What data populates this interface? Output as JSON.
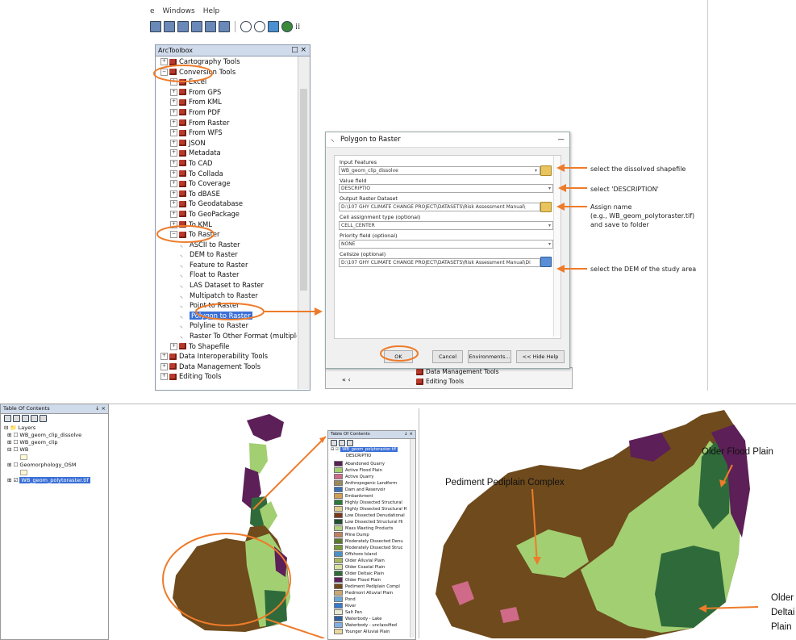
{
  "menubar": {
    "items": [
      "e",
      "Windows",
      "Help"
    ]
  },
  "arctoolbox": {
    "title": "ArcToolbox",
    "controls": "□ ×",
    "rows": [
      {
        "indent": 0,
        "type": "toolbox",
        "pm": "+",
        "label": "Cartography Tools"
      },
      {
        "indent": 0,
        "type": "toolbox",
        "pm": "−",
        "label": "Conversion Tools"
      },
      {
        "indent": 1,
        "type": "toolbox",
        "pm": "+",
        "label": "Excel"
      },
      {
        "indent": 1,
        "type": "toolbox",
        "pm": "+",
        "label": "From GPS"
      },
      {
        "indent": 1,
        "type": "toolbox",
        "pm": "+",
        "label": "From KML"
      },
      {
        "indent": 1,
        "type": "toolbox",
        "pm": "+",
        "label": "From PDF"
      },
      {
        "indent": 1,
        "type": "toolbox",
        "pm": "+",
        "label": "From Raster"
      },
      {
        "indent": 1,
        "type": "toolbox",
        "pm": "+",
        "label": "From WFS"
      },
      {
        "indent": 1,
        "type": "toolbox",
        "pm": "+",
        "label": "JSON"
      },
      {
        "indent": 1,
        "type": "toolbox",
        "pm": "+",
        "label": "Metadata"
      },
      {
        "indent": 1,
        "type": "toolbox",
        "pm": "+",
        "label": "To CAD"
      },
      {
        "indent": 1,
        "type": "toolbox",
        "pm": "+",
        "label": "To Collada"
      },
      {
        "indent": 1,
        "type": "toolbox",
        "pm": "+",
        "label": "To Coverage"
      },
      {
        "indent": 1,
        "type": "toolbox",
        "pm": "+",
        "label": "To dBASE"
      },
      {
        "indent": 1,
        "type": "toolbox",
        "pm": "+",
        "label": "To Geodatabase"
      },
      {
        "indent": 1,
        "type": "toolbox",
        "pm": "+",
        "label": "To GeoPackage"
      },
      {
        "indent": 1,
        "type": "toolbox",
        "pm": "+",
        "label": "To KML"
      },
      {
        "indent": 1,
        "type": "toolbox",
        "pm": "−",
        "label": "To Raster"
      },
      {
        "indent": 2,
        "type": "tool",
        "label": "ASCII to Raster"
      },
      {
        "indent": 2,
        "type": "tool",
        "label": "DEM to Raster"
      },
      {
        "indent": 2,
        "type": "tool",
        "label": "Feature to Raster"
      },
      {
        "indent": 2,
        "type": "tool",
        "label": "Float to Raster"
      },
      {
        "indent": 2,
        "type": "tool",
        "label": "LAS Dataset to Raster"
      },
      {
        "indent": 2,
        "type": "tool",
        "label": "Multipatch to Raster"
      },
      {
        "indent": 2,
        "type": "tool",
        "label": "Point to Raster"
      },
      {
        "indent": 2,
        "type": "tool",
        "label": "Polygon to Raster",
        "selected": true
      },
      {
        "indent": 2,
        "type": "tool",
        "label": "Polyline to Raster"
      },
      {
        "indent": 2,
        "type": "tool",
        "label": "Raster To Other Format (multiple)"
      },
      {
        "indent": 1,
        "type": "toolbox",
        "pm": "+",
        "label": "To Shapefile"
      },
      {
        "indent": 0,
        "type": "toolbox",
        "pm": "+",
        "label": "Data Interoperability Tools"
      },
      {
        "indent": 0,
        "type": "toolbox",
        "pm": "+",
        "label": "Data Management Tools"
      },
      {
        "indent": 0,
        "type": "toolbox",
        "pm": "+",
        "label": "Editing Tools"
      }
    ]
  },
  "dialog": {
    "title": "Polygon to Raster",
    "close": "—",
    "input_features_label": "Input Features",
    "input_features_value": "WB_geom_clip_dissolve",
    "value_field_label": "Value field",
    "value_field_value": "DESCRIPTIO",
    "output_label": "Output Raster Dataset",
    "output_value": "D:\\107 GHY CLIMATE CHANGE PROJECT\\DATASETS\\Risk Assessment Manual\\",
    "cell_assign_label": "Cell assignment type (optional)",
    "cell_assign_value": "CELL_CENTER",
    "priority_label": "Priority field (optional)",
    "priority_value": "NONE",
    "cellsize_label": "Cellsize (optional)",
    "cellsize_value": "D:\\107 GHY CLIMATE CHANGE PROJECT\\DATASETS\\Risk Assessment Manual\\Di",
    "ok": "OK",
    "cancel": "Cancel",
    "environments": "Environments...",
    "hide_help": "<< Hide Help"
  },
  "behind_dialog": {
    "row1": "Data Management Tools",
    "row2": "Editing Tools"
  },
  "annotations": {
    "a1": "select the dissolved shapefile",
    "a2": "select 'DESCRIPTION'",
    "a3_line1": "Assign name",
    "a3_line2": "(e.g., WB_geom_polytoraster.tif)",
    "a3_line3": "and save to folder",
    "a4": "select the DEM of the study area"
  },
  "toc": {
    "title": "Table Of Contents",
    "close": "↓ ×",
    "layers": [
      "Layers",
      "WB_geom_clip_dissolve",
      "WB_geom_clip",
      "WB",
      "Geomorphology_OSM",
      "WB_geom_polytoraster.tif"
    ]
  },
  "legend": {
    "title": "Table Of Contents",
    "header": "WB_geom_polytoraster.tif",
    "sub": "DESCRIPTIO",
    "items": [
      {
        "label": "Abandoned Quarry",
        "color": "#5a1f55"
      },
      {
        "label": "Active Flood Plain",
        "color": "#a2cf72"
      },
      {
        "label": "Active Quarry",
        "color": "#cf6a88"
      },
      {
        "label": "Anthropogenic Landform",
        "color": "#9a8a56"
      },
      {
        "label": "Dam and Reservoir",
        "color": "#3b6fb3"
      },
      {
        "label": "Embankment",
        "color": "#d0a050"
      },
      {
        "label": "Highly Dissected Structural",
        "color": "#2c7a3a"
      },
      {
        "label": "Highly Dissected Structural H",
        "color": "#e0cc8a"
      },
      {
        "label": "Low Dissected Denudational",
        "color": "#7a3a1a"
      },
      {
        "label": "Low Dissected Structural Hi",
        "color": "#1f4f30"
      },
      {
        "label": "Mass Wasting Products",
        "color": "#b0d080"
      },
      {
        "label": "Mine Dump",
        "color": "#c08060"
      },
      {
        "label": "Moderately Dissected Denu",
        "color": "#5a7a2a"
      },
      {
        "label": "Moderately Dissected Struc",
        "color": "#7a9a3a"
      },
      {
        "label": "Offshore Island",
        "color": "#4a8fc8"
      },
      {
        "label": "Older Alluvial Plain",
        "color": "#a8b860"
      },
      {
        "label": "Older Coastal Plain",
        "color": "#d8e0a0"
      },
      {
        "label": "Older Deltaic Plain",
        "color": "#2f6b3a"
      },
      {
        "label": "Older Flood Plain",
        "color": "#5c1f58"
      },
      {
        "label": "Pediment Pediplain Compl",
        "color": "#6e4a1c"
      },
      {
        "label": "Piedmont Alluvial Plain",
        "color": "#c8a870"
      },
      {
        "label": "Pond",
        "color": "#6aa8d8"
      },
      {
        "label": "River",
        "color": "#3a78c8"
      },
      {
        "label": "Salt Pan",
        "color": "#e8e8d0"
      },
      {
        "label": "Waterbody - Lake",
        "color": "#2f5f9f"
      },
      {
        "label": "Waterbody - unclassified",
        "color": "#80b0e0"
      },
      {
        "label": "Younger Alluvial Plain",
        "color": "#e8d8a0"
      }
    ]
  },
  "map_labels": {
    "older_flood": "Older Flood Plain",
    "pediment": "Pediment Pediplain Complex",
    "older_delta_1": "Older",
    "older_delta_2": "Deltai",
    "older_delta_3": "Plain"
  },
  "colors": {
    "accent": "#ee7b2a",
    "selected": "#3a6fd6",
    "flood": "#a2cf72",
    "pediment": "#6e4a1c",
    "purple": "#5c1f58",
    "delta": "#2f6b3a"
  }
}
